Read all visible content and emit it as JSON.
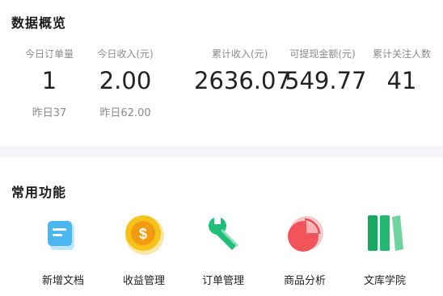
{
  "overview": {
    "title": "数据概览",
    "stats": [
      {
        "label": "今日订单量",
        "value": "1",
        "yesterday": "昨日37"
      },
      {
        "label": "今日收入(元)",
        "value": "2.00",
        "yesterday": "昨日62.00"
      },
      {
        "label": "累计收入(元)",
        "value": "2636.07",
        "yesterday": ""
      },
      {
        "label": "可提现金额(元)",
        "value": "549.77",
        "yesterday": ""
      },
      {
        "label": "累计关注人数",
        "value": "41",
        "yesterday": ""
      }
    ]
  },
  "functions": {
    "title": "常用功能",
    "items": [
      {
        "label": "新增文档",
        "icon": "document-icon"
      },
      {
        "label": "收益管理",
        "icon": "coin-icon"
      },
      {
        "label": "订单管理",
        "icon": "wrench-icon"
      },
      {
        "label": "商品分析",
        "icon": "pie-chart-icon"
      },
      {
        "label": "文库学院",
        "icon": "books-icon"
      }
    ]
  },
  "colors": {
    "doc_blue": "#4cb6f2",
    "coin_yellow": "#f7c21a",
    "wrench_green": "#1fbf7a",
    "pie_red": "#f2545b",
    "books_green": "#17a862"
  }
}
